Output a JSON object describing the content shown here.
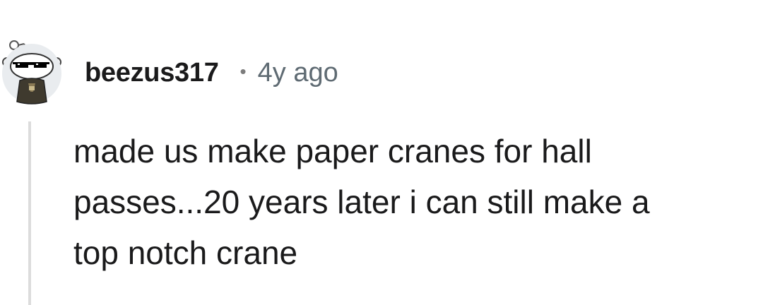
{
  "comment": {
    "avatar_icon": "snoo-sunglasses-icon",
    "username": "beezus317",
    "separator": "•",
    "timestamp": "4y ago",
    "body_lines": [
      "made us make paper cranes for hall",
      "passes...20 years later i can still make a",
      "top notch crane"
    ]
  },
  "colors": {
    "username": "#1a1a1b",
    "timestamp": "#5f6b73",
    "thread_line": "#dcdcdc",
    "background": "#ffffff"
  }
}
